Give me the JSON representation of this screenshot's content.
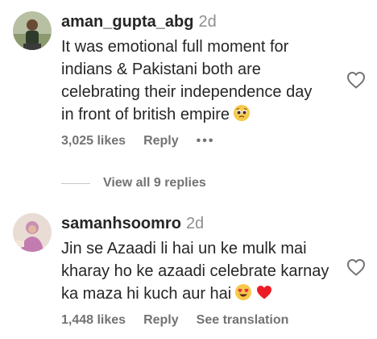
{
  "comments": [
    {
      "username": "aman_gupta_abg",
      "time": "2d",
      "lines": [
        "It was emotional full moment for",
        "indians & Pakistani both are",
        "celebrating their independence day",
        "in front of british empire"
      ],
      "trailing_emoji": "pleading-face-emoji",
      "likes": "3,025 likes",
      "reply": "Reply",
      "more": "•••"
    },
    {
      "username": "samanhsoomro",
      "time": "2d",
      "lines": [
        "Jin se Azaadi li hai un ke mulk mai",
        "kharay ho ke azaadi celebrate karnay",
        "ka maza hi kuch aur hai"
      ],
      "trailing_emojis": [
        "heart-eyes-emoji",
        "red-heart-emoji"
      ],
      "likes": "1,448 likes",
      "reply": "Reply",
      "see_translation": "See translation"
    }
  ],
  "view_replies": "View all 9 replies",
  "colors": {
    "text": "#262626",
    "muted": "#737373",
    "heart_red": "#ed1c24"
  },
  "icons": [
    "like-heart-outline-icon"
  ]
}
